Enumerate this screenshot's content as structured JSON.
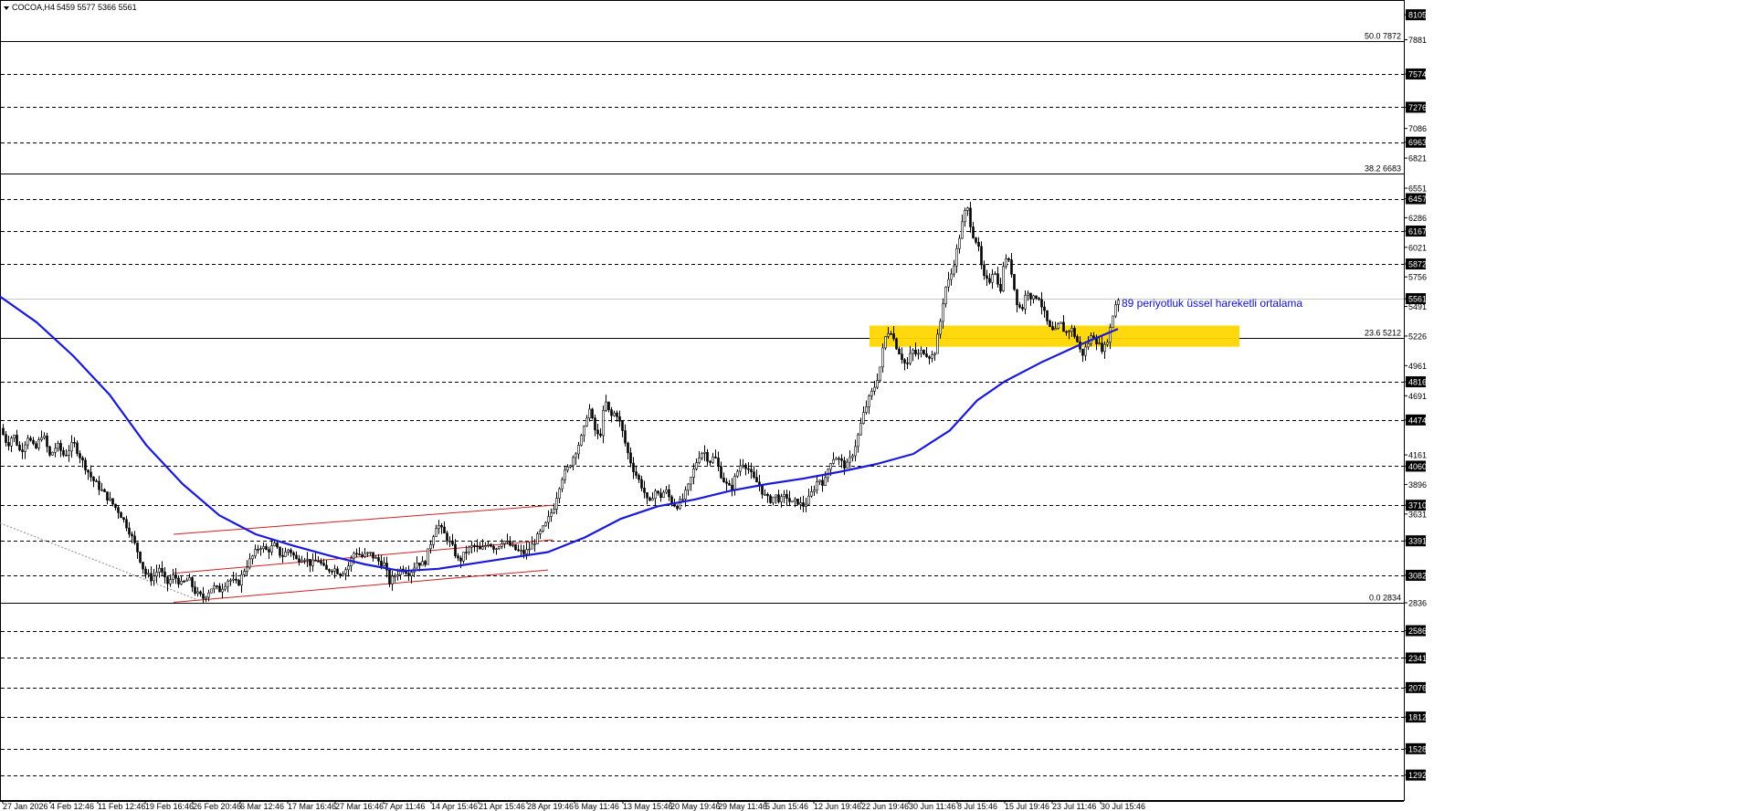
{
  "header": {
    "symbol_label": "COCOA,H4",
    "ohlc_text": "5459 5577 5366 5561"
  },
  "annotation": {
    "text": "89 periyotluk üssel hareketli ortalama"
  },
  "colors": {
    "background": "#ffffff",
    "candle": "#000000",
    "ema": "#1a1ad6",
    "channel": "#d02020",
    "zone": "#ffd700",
    "grid": "#000000"
  },
  "chart_data": {
    "type": "candlestick",
    "ylim": [
      1060,
      8180
    ],
    "price_labels": [
      {
        "value": 8105,
        "text": "8105",
        "boxed": true
      },
      {
        "value": 7881,
        "text": "7881",
        "boxed": false
      },
      {
        "value": 7574,
        "text": "7574",
        "boxed": true
      },
      {
        "value": 7276,
        "text": "7276",
        "boxed": true
      },
      {
        "value": 7086,
        "text": "7086",
        "boxed": false
      },
      {
        "value": 6963,
        "text": "6963",
        "boxed": true
      },
      {
        "value": 6821,
        "text": "6821",
        "boxed": false
      },
      {
        "value": 6551,
        "text": "6551",
        "boxed": false
      },
      {
        "value": 6457,
        "text": "6457",
        "boxed": true
      },
      {
        "value": 6286,
        "text": "6286",
        "boxed": false
      },
      {
        "value": 6167,
        "text": "6167",
        "boxed": true
      },
      {
        "value": 6021,
        "text": "6021",
        "boxed": false
      },
      {
        "value": 5872,
        "text": "5872",
        "boxed": true
      },
      {
        "value": 5756,
        "text": "5756",
        "boxed": false
      },
      {
        "value": 5561,
        "text": "5561",
        "boxed": true
      },
      {
        "value": 5491,
        "text": "5491",
        "boxed": false
      },
      {
        "value": 5226,
        "text": "5226",
        "boxed": false
      },
      {
        "value": 4961,
        "text": "4961",
        "boxed": false
      },
      {
        "value": 4816,
        "text": "4816",
        "boxed": true
      },
      {
        "value": 4691,
        "text": "4691",
        "boxed": false
      },
      {
        "value": 4474,
        "text": "4474",
        "boxed": true
      },
      {
        "value": 4161,
        "text": "4161",
        "boxed": false
      },
      {
        "value": 4060,
        "text": "4060",
        "boxed": true
      },
      {
        "value": 3896,
        "text": "3896",
        "boxed": false
      },
      {
        "value": 3710,
        "text": "3710",
        "boxed": true
      },
      {
        "value": 3631,
        "text": "3631",
        "boxed": false
      },
      {
        "value": 3391,
        "text": "3391",
        "boxed": true
      },
      {
        "value": 3082,
        "text": "3082",
        "boxed": true
      },
      {
        "value": 2836,
        "text": "2836",
        "boxed": false
      },
      {
        "value": 2586,
        "text": "2586",
        "boxed": true
      },
      {
        "value": 2341,
        "text": "2341",
        "boxed": true
      },
      {
        "value": 2076,
        "text": "2076",
        "boxed": true
      },
      {
        "value": 1812,
        "text": "1812",
        "boxed": true
      },
      {
        "value": 1528,
        "text": "1528",
        "boxed": true
      },
      {
        "value": 1292,
        "text": "1292",
        "boxed": true
      }
    ],
    "dashed_levels": [
      7574,
      7276,
      6963,
      6457,
      6167,
      5872,
      4816,
      4474,
      4060,
      3710,
      3391,
      3082,
      2586,
      2341,
      2076,
      1812,
      1528,
      1292
    ],
    "fib_levels": [
      {
        "label": "50.0 7872",
        "value": 7872
      },
      {
        "label": "38.2 6683",
        "value": 6683
      },
      {
        "label": "23.6 5212",
        "value": 5212
      },
      {
        "label": "0.0 2834",
        "value": 2834
      }
    ],
    "current_price": 5561,
    "x_labels": [
      "27 Jan 2026",
      "4 Feb 12:46",
      "11 Feb 12:46",
      "19 Feb 16:46",
      "26 Feb 20:46",
      "6 Mar 12:46",
      "17 Mar 16:46",
      "27 Mar 16:46",
      "7 Apr 11:46",
      "14 Apr 15:46",
      "21 Apr 15:46",
      "28 Apr 19:46",
      "6 May 11:46",
      "13 May 15:46",
      "20 May 19:46",
      "29 May 11:46",
      "5 Jun 15:46",
      "12 Jun 19:46",
      "22 Jun 19:46",
      "30 Jun 11:46",
      "8 Jul 15:46",
      "15 Jul 19:46",
      "23 Jul 11:46",
      "30 Jul 15:46"
    ],
    "price_path": [
      [
        0,
        4400
      ],
      [
        8,
        4250
      ],
      [
        14,
        4350
      ],
      [
        22,
        4180
      ],
      [
        30,
        4330
      ],
      [
        38,
        4200
      ],
      [
        46,
        4360
      ],
      [
        54,
        4150
      ],
      [
        62,
        4250
      ],
      [
        70,
        4150
      ],
      [
        80,
        4270
      ],
      [
        90,
        4100
      ],
      [
        100,
        3950
      ],
      [
        110,
        3850
      ],
      [
        120,
        3750
      ],
      [
        130,
        3650
      ],
      [
        140,
        3500
      ],
      [
        150,
        3300
      ],
      [
        158,
        3100
      ],
      [
        166,
        3050
      ],
      [
        174,
        3150
      ],
      [
        182,
        3000
      ],
      [
        190,
        3080
      ],
      [
        198,
        3000
      ],
      [
        206,
        3050
      ],
      [
        214,
        2920
      ],
      [
        222,
        2880
      ],
      [
        232,
        2980
      ],
      [
        240,
        2950
      ],
      [
        250,
        3050
      ],
      [
        260,
        3000
      ],
      [
        268,
        3150
      ],
      [
        276,
        3250
      ],
      [
        284,
        3350
      ],
      [
        292,
        3300
      ],
      [
        300,
        3350
      ],
      [
        308,
        3250
      ],
      [
        316,
        3320
      ],
      [
        324,
        3220
      ],
      [
        332,
        3250
      ],
      [
        340,
        3180
      ],
      [
        348,
        3220
      ],
      [
        356,
        3120
      ],
      [
        364,
        3150
      ],
      [
        372,
        3100
      ],
      [
        380,
        3150
      ],
      [
        388,
        3300
      ],
      [
        396,
        3250
      ],
      [
        404,
        3280
      ],
      [
        412,
        3220
      ],
      [
        420,
        3180
      ],
      [
        426,
        3020
      ],
      [
        432,
        3080
      ],
      [
        440,
        3150
      ],
      [
        448,
        3100
      ],
      [
        456,
        3200
      ],
      [
        464,
        3180
      ],
      [
        472,
        3400
      ],
      [
        478,
        3550
      ],
      [
        486,
        3450
      ],
      [
        494,
        3350
      ],
      [
        502,
        3200
      ],
      [
        510,
        3300
      ],
      [
        518,
        3350
      ],
      [
        526,
        3300
      ],
      [
        534,
        3380
      ],
      [
        542,
        3320
      ],
      [
        550,
        3400
      ],
      [
        558,
        3350
      ],
      [
        566,
        3300
      ],
      [
        574,
        3280
      ],
      [
        582,
        3350
      ],
      [
        590,
        3450
      ],
      [
        598,
        3550
      ],
      [
        606,
        3700
      ],
      [
        614,
        3950
      ],
      [
        622,
        4050
      ],
      [
        630,
        4200
      ],
      [
        638,
        4350
      ],
      [
        644,
        4600
      ],
      [
        650,
        4400
      ],
      [
        656,
        4300
      ],
      [
        662,
        4650
      ],
      [
        668,
        4500
      ],
      [
        674,
        4550
      ],
      [
        680,
        4400
      ],
      [
        686,
        4200
      ],
      [
        692,
        4050
      ],
      [
        698,
        3950
      ],
      [
        704,
        3850
      ],
      [
        710,
        3700
      ],
      [
        716,
        3850
      ],
      [
        722,
        3780
      ],
      [
        728,
        3850
      ],
      [
        734,
        3750
      ],
      [
        740,
        3700
      ],
      [
        746,
        3750
      ],
      [
        752,
        3850
      ],
      [
        758,
        4000
      ],
      [
        764,
        4150
      ],
      [
        770,
        4200
      ],
      [
        776,
        4100
      ],
      [
        782,
        4150
      ],
      [
        788,
        4000
      ],
      [
        794,
        3900
      ],
      [
        800,
        3850
      ],
      [
        806,
        4000
      ],
      [
        812,
        4100
      ],
      [
        818,
        4050
      ],
      [
        824,
        3950
      ],
      [
        830,
        3900
      ],
      [
        836,
        3800
      ],
      [
        842,
        3750
      ],
      [
        848,
        3800
      ],
      [
        854,
        3750
      ],
      [
        860,
        3800
      ],
      [
        866,
        3720
      ],
      [
        872,
        3750
      ],
      [
        878,
        3700
      ],
      [
        884,
        3750
      ],
      [
        890,
        3850
      ],
      [
        896,
        3950
      ],
      [
        902,
        3900
      ],
      [
        908,
        4100
      ],
      [
        914,
        4150
      ],
      [
        920,
        4100
      ],
      [
        926,
        4050
      ],
      [
        932,
        4150
      ],
      [
        938,
        4300
      ],
      [
        944,
        4500
      ],
      [
        950,
        4650
      ],
      [
        956,
        4750
      ],
      [
        962,
        4900
      ],
      [
        968,
        5200
      ],
      [
        974,
        5300
      ],
      [
        980,
        5150
      ],
      [
        986,
        5050
      ],
      [
        992,
        4950
      ],
      [
        998,
        5100
      ],
      [
        1004,
        5050
      ],
      [
        1010,
        5100
      ],
      [
        1016,
        5050
      ],
      [
        1022,
        5050
      ],
      [
        1028,
        5300
      ],
      [
        1034,
        5650
      ],
      [
        1040,
        5750
      ],
      [
        1046,
        5950
      ],
      [
        1052,
        6200
      ],
      [
        1058,
        6400
      ],
      [
        1064,
        6150
      ],
      [
        1070,
        6050
      ],
      [
        1076,
        5750
      ],
      [
        1082,
        5700
      ],
      [
        1088,
        5850
      ],
      [
        1094,
        5600
      ],
      [
        1100,
        5950
      ],
      [
        1106,
        5850
      ],
      [
        1112,
        5550
      ],
      [
        1118,
        5450
      ],
      [
        1124,
        5650
      ],
      [
        1130,
        5550
      ],
      [
        1136,
        5600
      ],
      [
        1142,
        5450
      ],
      [
        1148,
        5300
      ],
      [
        1154,
        5250
      ],
      [
        1160,
        5350
      ],
      [
        1166,
        5250
      ],
      [
        1172,
        5300
      ],
      [
        1178,
        5200
      ],
      [
        1184,
        5050
      ],
      [
        1190,
        5150
      ],
      [
        1196,
        5250
      ],
      [
        1202,
        5150
      ],
      [
        1208,
        5100
      ],
      [
        1214,
        5250
      ],
      [
        1220,
        5500
      ],
      [
        1224,
        5561
      ]
    ],
    "ema_path": [
      [
        0,
        5580
      ],
      [
        40,
        5350
      ],
      [
        80,
        5050
      ],
      [
        120,
        4700
      ],
      [
        160,
        4250
      ],
      [
        200,
        3900
      ],
      [
        240,
        3620
      ],
      [
        280,
        3450
      ],
      [
        320,
        3350
      ],
      [
        360,
        3260
      ],
      [
        400,
        3180
      ],
      [
        440,
        3120
      ],
      [
        480,
        3140
      ],
      [
        520,
        3190
      ],
      [
        560,
        3240
      ],
      [
        600,
        3290
      ],
      [
        640,
        3420
      ],
      [
        680,
        3590
      ],
      [
        720,
        3700
      ],
      [
        760,
        3760
      ],
      [
        800,
        3840
      ],
      [
        840,
        3900
      ],
      [
        880,
        3950
      ],
      [
        920,
        4010
      ],
      [
        960,
        4080
      ],
      [
        1000,
        4170
      ],
      [
        1040,
        4380
      ],
      [
        1070,
        4650
      ],
      [
        1100,
        4820
      ],
      [
        1140,
        4990
      ],
      [
        1180,
        5140
      ],
      [
        1224,
        5290
      ]
    ],
    "channel_lines": [
      [
        [
          190,
          3450
        ],
        [
          605,
          3710
        ]
      ],
      [
        [
          190,
          3100
        ],
        [
          605,
          3400
        ]
      ],
      [
        [
          190,
          2840
        ],
        [
          600,
          3130
        ]
      ]
    ],
    "dotted_line": [
      [
        0,
        3550
      ],
      [
        220,
        2850
      ]
    ],
    "zone": {
      "x1": 952,
      "x2": 1357,
      "y_low": 5130,
      "y_high": 5320
    }
  }
}
